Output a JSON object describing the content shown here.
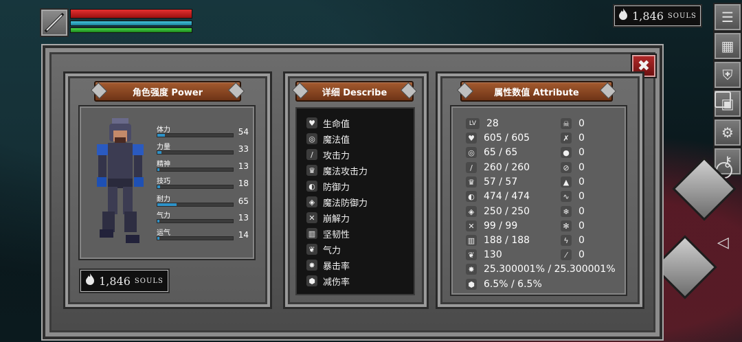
{
  "souls_top": {
    "value": "1,846",
    "unit": "SOULS"
  },
  "souls_panel": {
    "value": "1,846",
    "unit": "SOULS"
  },
  "power": {
    "title": "角色强度 Power",
    "stats": [
      {
        "label": "体力",
        "value": "54",
        "fill": 0.1
      },
      {
        "label": "力量",
        "value": "33",
        "fill": 0.05
      },
      {
        "label": "精神",
        "value": "13",
        "fill": 0.03
      },
      {
        "label": "技巧",
        "value": "18",
        "fill": 0.04
      },
      {
        "label": "耐力",
        "value": "65",
        "fill": 0.25
      },
      {
        "label": "气力",
        "value": "13",
        "fill": 0.03
      },
      {
        "label": "运气",
        "value": "14",
        "fill": 0.03
      }
    ]
  },
  "describe": {
    "title": "详细 Describe",
    "items": [
      {
        "label": "生命值",
        "icon": "heart-icon"
      },
      {
        "label": "魔法值",
        "icon": "brain-icon"
      },
      {
        "label": "攻击力",
        "icon": "sword-icon"
      },
      {
        "label": "魔法攻击力",
        "icon": "magic-attack-icon"
      },
      {
        "label": "防御力",
        "icon": "shield-icon"
      },
      {
        "label": "魔法防御力",
        "icon": "magic-shield-icon"
      },
      {
        "label": "崩解力",
        "icon": "break-icon"
      },
      {
        "label": "坚韧性",
        "icon": "armor-icon"
      },
      {
        "label": "气力",
        "icon": "lungs-icon"
      },
      {
        "label": "暴击率",
        "icon": "critical-icon"
      },
      {
        "label": "减伤率",
        "icon": "damage-reduce-icon"
      }
    ]
  },
  "attribute": {
    "title": "属性数值 Attribute",
    "left": [
      {
        "icon": "level-icon",
        "value": "28"
      },
      {
        "icon": "heart-icon",
        "value": "605 / 605"
      },
      {
        "icon": "brain-icon",
        "value": "65 / 65"
      },
      {
        "icon": "sword-icon",
        "value": "260 / 260"
      },
      {
        "icon": "magic-attack-icon",
        "value": "57 / 57"
      },
      {
        "icon": "shield-icon",
        "value": "474 / 474"
      },
      {
        "icon": "magic-shield-icon",
        "value": "250 / 250"
      },
      {
        "icon": "break-icon",
        "value": "99 / 99"
      },
      {
        "icon": "armor-icon",
        "value": "188 / 188"
      },
      {
        "icon": "lungs-icon",
        "value": "130"
      },
      {
        "icon": "critical-icon",
        "value": "25.300001% / 25.300001%"
      },
      {
        "icon": "damage-reduce-icon",
        "value": "6.5% / 6.5%"
      }
    ],
    "right": [
      {
        "icon": "skull-icon",
        "value": "0"
      },
      {
        "icon": "crossed-bones-icon",
        "value": "0"
      },
      {
        "icon": "water-drop-icon",
        "value": "0"
      },
      {
        "icon": "no-drop-icon",
        "value": "0"
      },
      {
        "icon": "fire-icon",
        "value": "0"
      },
      {
        "icon": "curse-icon",
        "value": "0"
      },
      {
        "icon": "frost-icon",
        "value": "0"
      },
      {
        "icon": "snowflake-icon",
        "value": "0"
      },
      {
        "icon": "lightning-icon",
        "value": "0"
      },
      {
        "icon": "slash-icon",
        "value": "0"
      }
    ]
  }
}
